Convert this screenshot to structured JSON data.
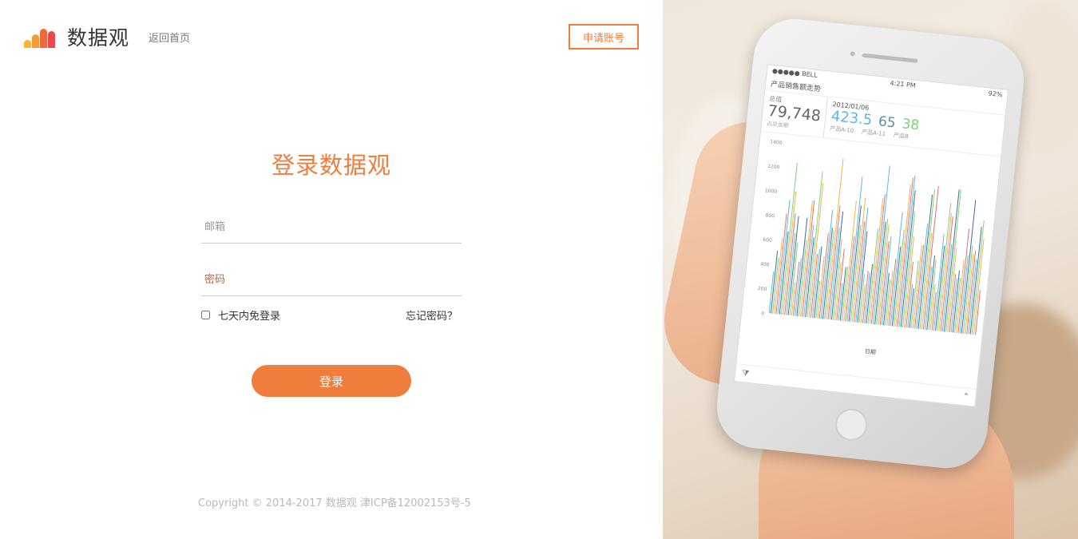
{
  "header": {
    "brand": "数据观",
    "back_home": "返回首页",
    "apply_account": "申请账号",
    "logo_colors": [
      "#f7b733",
      "#f59a3b",
      "#f0683c",
      "#e94a4f"
    ]
  },
  "login": {
    "title": "登录数据观",
    "email_placeholder": "邮箱",
    "password_placeholder": "密码",
    "remember_label": "七天内免登录",
    "remember_checked": false,
    "forgot_label": "忘记密码？",
    "submit_label": "登录"
  },
  "footer": {
    "copyright": "Copyright © 2014-2017 数据观 津ICP备12002153号-5"
  },
  "theme": {
    "accent": "#ef7d3c"
  },
  "phone_screen": {
    "status_left": "●●●●● BELL",
    "status_time": "4:21 PM",
    "status_right": "92%",
    "app_title": "产品销售额走势",
    "kpi_total_label": "总值",
    "kpi_total_value": "79,748",
    "kpi_total_sub": "占总金额",
    "kpi_date": "2012/01/06",
    "kpi_values": [
      "423.5",
      "65",
      "38"
    ],
    "kpi_value_labels": [
      "产品A-10",
      "产品A-11",
      "产品B"
    ],
    "y_ticks": [
      "1400",
      "1200",
      "1000",
      "800",
      "600",
      "400",
      "200",
      "0"
    ],
    "x_axis_label": "日期"
  }
}
